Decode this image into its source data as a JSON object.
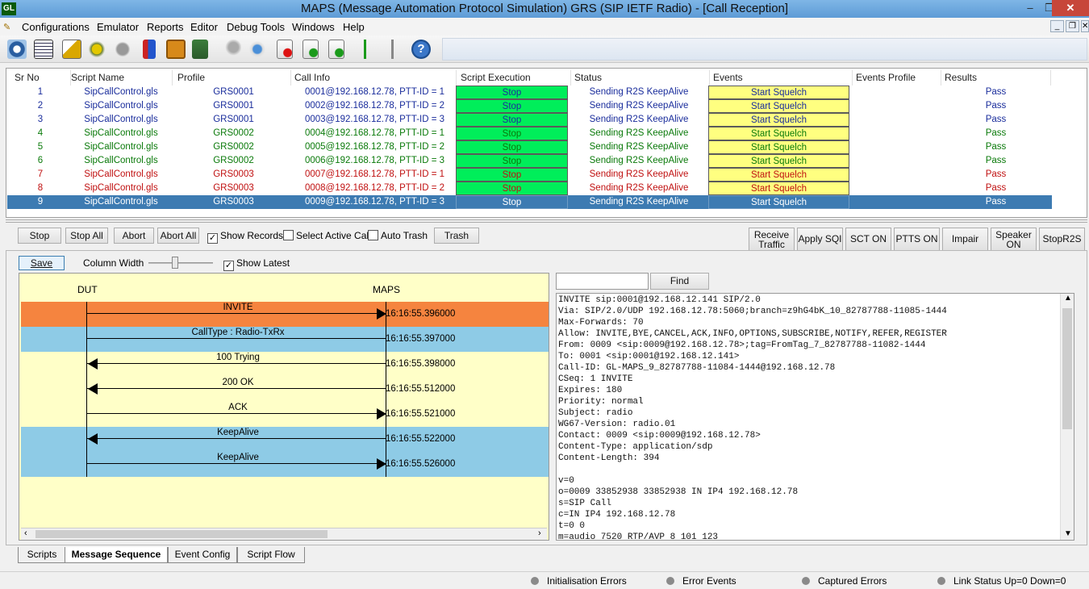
{
  "window": {
    "title": "MAPS (Message Automation Protocol Simulation) GRS (SIP IETF Radio) - [Call Reception]",
    "minimize": "–",
    "maximize": "❐",
    "close": "✕"
  },
  "menu": [
    "Configurations",
    "Emulator",
    "Reports",
    "Editor",
    "Debug Tools",
    "Windows",
    "Help"
  ],
  "mdi_controls": [
    "_",
    "❐",
    "✕"
  ],
  "toolbar_icons": [
    "settings-icon",
    "script-list-icon",
    "profile-edit-icon",
    "call-generation-icon",
    "call-reception-icon",
    "bulk-call-icon",
    "briefcase-icon",
    "database-lock-icon",
    "wrench-icon",
    "run-tool-icon",
    "stop-record-icon",
    "capture-record-icon",
    "play-record-icon",
    "call-flow-icon",
    "connection-icon",
    "help-icon"
  ],
  "grid": {
    "headers": [
      "Sr No",
      "Script Name",
      "Profile",
      "Call Info",
      "Script Execution",
      "Status",
      "Events",
      "Events Profile",
      "Results"
    ],
    "rows": [
      {
        "sr": "1",
        "script": "SipCallControl.gls",
        "profile": "GRS0001",
        "call": "0001@192.168.12.78, PTT-ID = 1",
        "exec": "Stop",
        "status": "Sending R2S KeepAlive",
        "event": "Start Squelch",
        "evprof": "",
        "result": "Pass",
        "color": "blue"
      },
      {
        "sr": "2",
        "script": "SipCallControl.gls",
        "profile": "GRS0001",
        "call": "0002@192.168.12.78, PTT-ID = 2",
        "exec": "Stop",
        "status": "Sending R2S KeepAlive",
        "event": "Start Squelch",
        "evprof": "",
        "result": "Pass",
        "color": "blue"
      },
      {
        "sr": "3",
        "script": "SipCallControl.gls",
        "profile": "GRS0001",
        "call": "0003@192.168.12.78, PTT-ID = 3",
        "exec": "Stop",
        "status": "Sending R2S KeepAlive",
        "event": "Start Squelch",
        "evprof": "",
        "result": "Pass",
        "color": "blue"
      },
      {
        "sr": "4",
        "script": "SipCallControl.gls",
        "profile": "GRS0002",
        "call": "0004@192.168.12.78, PTT-ID = 1",
        "exec": "Stop",
        "status": "Sending R2S KeepAlive",
        "event": "Start Squelch",
        "evprof": "",
        "result": "Pass",
        "color": "green"
      },
      {
        "sr": "5",
        "script": "SipCallControl.gls",
        "profile": "GRS0002",
        "call": "0005@192.168.12.78, PTT-ID = 2",
        "exec": "Stop",
        "status": "Sending R2S KeepAlive",
        "event": "Start Squelch",
        "evprof": "",
        "result": "Pass",
        "color": "green"
      },
      {
        "sr": "6",
        "script": "SipCallControl.gls",
        "profile": "GRS0002",
        "call": "0006@192.168.12.78, PTT-ID = 3",
        "exec": "Stop",
        "status": "Sending R2S KeepAlive",
        "event": "Start Squelch",
        "evprof": "",
        "result": "Pass",
        "color": "green"
      },
      {
        "sr": "7",
        "script": "SipCallControl.gls",
        "profile": "GRS0003",
        "call": "0007@192.168.12.78, PTT-ID = 1",
        "exec": "Stop",
        "status": "Sending R2S KeepAlive",
        "event": "Start Squelch",
        "evprof": "",
        "result": "Pass",
        "color": "red"
      },
      {
        "sr": "8",
        "script": "SipCallControl.gls",
        "profile": "GRS0003",
        "call": "0008@192.168.12.78, PTT-ID = 2",
        "exec": "Stop",
        "status": "Sending R2S KeepAlive",
        "event": "Start Squelch",
        "evprof": "",
        "result": "Pass",
        "color": "red"
      },
      {
        "sr": "9",
        "script": "SipCallControl.gls",
        "profile": "GRS0003",
        "call": "0009@192.168.12.78, PTT-ID = 3",
        "exec": "Stop",
        "status": "Sending R2S KeepAlive",
        "event": "Start Squelch",
        "evprof": "",
        "result": "Pass",
        "color": "sel"
      }
    ]
  },
  "actions": {
    "stop": "Stop",
    "stop_all": "Stop All",
    "abort": "Abort",
    "abort_all": "Abort All",
    "show_records": "Show Records",
    "select_active_call": "Select Active Call",
    "auto_trash": "Auto Trash",
    "trash": "Trash",
    "receive_traffic": "Receive\nTraffic",
    "apply_sqi": "Apply SQI",
    "sct_on": "SCT ON",
    "ptts_on": "PTTS ON",
    "impair": "Impair",
    "speaker_on": "Speaker\nON",
    "stop_r2s": "StopR2S"
  },
  "seq_toolbar": {
    "save": "Save",
    "column_width": "Column Width",
    "show_latest": "Show Latest"
  },
  "sequence": {
    "left_entity": "DUT",
    "right_entity": "MAPS",
    "messages": [
      {
        "name": "INVITE",
        "ts": "16:16:55.396000",
        "dir": "right",
        "bg": "#f5843f"
      },
      {
        "name": "CallType : Radio-TxRx",
        "ts": "16:16:55.397000",
        "dir": "none",
        "bg": "#8ecbe6"
      },
      {
        "name": "100  Trying",
        "ts": "16:16:55.398000",
        "dir": "left",
        "bg": "#ffffc8"
      },
      {
        "name": "200  OK",
        "ts": "16:16:55.512000",
        "dir": "left",
        "bg": "#ffffc8"
      },
      {
        "name": "ACK",
        "ts": "16:16:55.521000",
        "dir": "right",
        "bg": "#ffffc8"
      },
      {
        "name": "KeepAlive",
        "ts": "16:16:55.522000",
        "dir": "left",
        "bg": "#8ecbe6"
      },
      {
        "name": "KeepAlive",
        "ts": "16:16:55.526000",
        "dir": "right",
        "bg": "#8ecbe6"
      }
    ]
  },
  "find": {
    "label": "Find",
    "value": ""
  },
  "detail_text": "INVITE sip:0001@192.168.12.141 SIP/2.0\nVia: SIP/2.0/UDP 192.168.12.78:5060;branch=z9hG4bK_10_82787788-11085-1444\nMax-Forwards: 70\nAllow: INVITE,BYE,CANCEL,ACK,INFO,OPTIONS,SUBSCRIBE,NOTIFY,REFER,REGISTER\nFrom: 0009 <sip:0009@192.168.12.78>;tag=FromTag_7_82787788-11082-1444\nTo: 0001 <sip:0001@192.168.12.141>\nCall-ID: GL-MAPS_9_82787788-11084-1444@192.168.12.78\nCSeq: 1 INVITE\nExpires: 180\nPriority: normal\nSubject: radio\nWG67-Version: radio.01\nContact: 0009 <sip:0009@192.168.12.78>\nContent-Type: application/sdp\nContent-Length: 394\n\nv=0\no=0009 33852938 33852938 IN IP4 192.168.12.78\ns=SIP Call\nc=IN IP4 192.168.12.78\nt=0 0\nm=audio 7520 RTP/AVP 8 101 123",
  "tabs": [
    "Scripts",
    "Message Sequence",
    "Event Config",
    "Script Flow"
  ],
  "status": [
    "Initialisation Errors",
    "Error Events",
    "Captured Errors",
    "Link Status Up=0 Down=0"
  ]
}
